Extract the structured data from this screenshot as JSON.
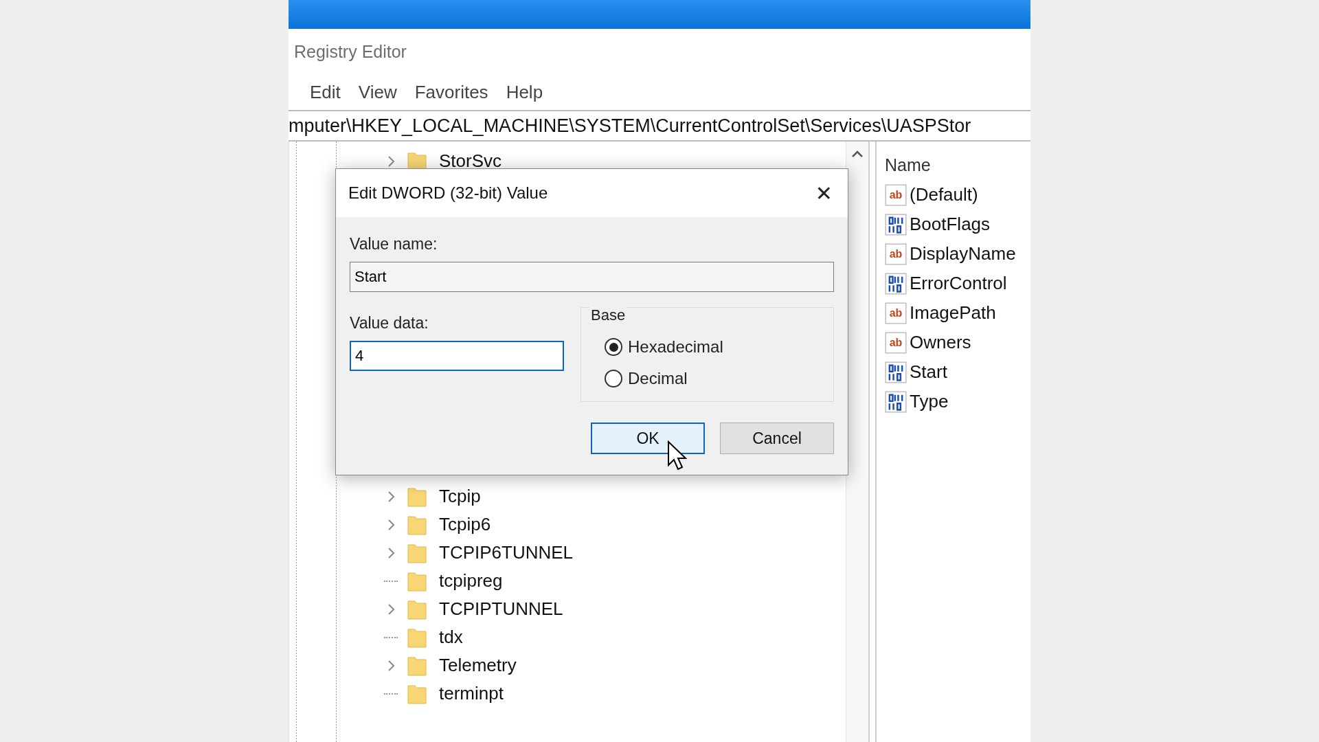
{
  "window": {
    "title": "Registry Editor"
  },
  "menu": [
    "Edit",
    "View",
    "Favorites",
    "Help"
  ],
  "address": "mputer\\HKEY_LOCAL_MACHINE\\SYSTEM\\CurrentControlSet\\Services\\UASPStor",
  "tree": [
    {
      "label": "StorSvc",
      "has_children": true
    },
    {
      "label": "Tcpip",
      "has_children": true
    },
    {
      "label": "Tcpip6",
      "has_children": true
    },
    {
      "label": "TCPIP6TUNNEL",
      "has_children": true
    },
    {
      "label": "tcpipreg",
      "has_children": false
    },
    {
      "label": "TCPIPTUNNEL",
      "has_children": true
    },
    {
      "label": "tdx",
      "has_children": false
    },
    {
      "label": "Telemetry",
      "has_children": true
    },
    {
      "label": "terminpt",
      "has_children": false
    }
  ],
  "values": {
    "column": "Name",
    "items": [
      {
        "name": "(Default)",
        "kind": "string",
        "icon_text": "ab"
      },
      {
        "name": "BootFlags",
        "kind": "binary"
      },
      {
        "name": "DisplayName",
        "kind": "string",
        "icon_text": "ab"
      },
      {
        "name": "ErrorControl",
        "kind": "binary"
      },
      {
        "name": "ImagePath",
        "kind": "string",
        "icon_text": "ab"
      },
      {
        "name": "Owners",
        "kind": "string",
        "icon_text": "ab"
      },
      {
        "name": "Start",
        "kind": "binary"
      },
      {
        "name": "Type",
        "kind": "binary"
      }
    ]
  },
  "dialog": {
    "title": "Edit DWORD (32-bit) Value",
    "close": "✕",
    "value_name_label": "Value name:",
    "value_name": "Start",
    "value_data_label": "Value data:",
    "value_data": "4",
    "base_label": "Base",
    "bases": [
      {
        "label": "Hexadecimal",
        "selected": true
      },
      {
        "label": "Decimal",
        "selected": false
      }
    ],
    "buttons": [
      {
        "label": "OK",
        "default": true
      },
      {
        "label": "Cancel",
        "default": false
      }
    ]
  }
}
